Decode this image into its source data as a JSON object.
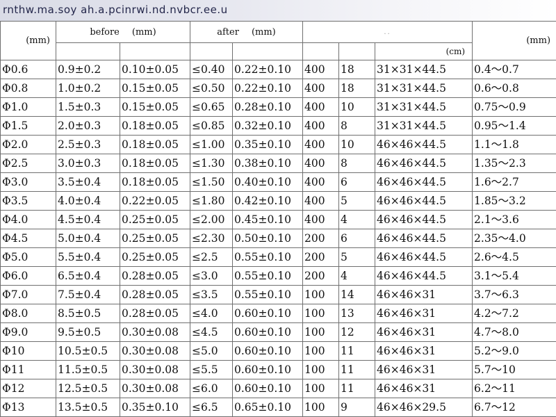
{
  "title": "rnthw.ma.soy ah.a.pcinrwi.nd.nvbcr.ee.u",
  "header": {
    "diameter_unit": "(mm)",
    "before_label": "before",
    "before_unit": "(mm)",
    "after_label": "after",
    "after_unit": "(mm)",
    "packing_mark": "..",
    "carton_unit": "(cm)",
    "range_unit": "(mm)"
  },
  "rows": [
    [
      "Φ0.6",
      "0.9±0.2",
      "0.10±0.05",
      "≤0.40",
      "0.22±0.10",
      "400",
      "18",
      "31×31×44.5",
      "0.4～0.7"
    ],
    [
      "Φ0.8",
      "1.0±0.2",
      "0.15±0.05",
      "≤0.50",
      "0.22±0.10",
      "400",
      "18",
      "31×31×44.5",
      "0.6～0.8"
    ],
    [
      "Φ1.0",
      "1.5±0.3",
      "0.15±0.05",
      "≤0.65",
      "0.28±0.10",
      "400",
      "10",
      "31×31×44.5",
      "0.75～0.9"
    ],
    [
      "Φ1.5",
      "2.0±0.3",
      "0.18±0.05",
      "≤0.85",
      "0.32±0.10",
      "400",
      "8",
      "31×31×44.5",
      "0.95～1.4"
    ],
    [
      "Φ2.0",
      "2.5±0.3",
      "0.18±0.05",
      "≤1.00",
      "0.35±0.10",
      "400",
      "10",
      "46×46×44.5",
      "1.1～1.8"
    ],
    [
      "Φ2.5",
      "3.0±0.3",
      "0.18±0.05",
      "≤1.30",
      "0.38±0.10",
      "400",
      "8",
      "46×46×44.5",
      "1.35～2.3"
    ],
    [
      "Φ3.0",
      "3.5±0.4",
      "0.18±0.05",
      "≤1.50",
      "0.40±0.10",
      "400",
      "6",
      "46×46×44.5",
      "1.6～2.7"
    ],
    [
      "Φ3.5",
      "4.0±0.4",
      "0.22±0.05",
      "≤1.80",
      "0.42±0.10",
      "400",
      "5",
      "46×46×44.5",
      "1.85～3.2"
    ],
    [
      "Φ4.0",
      "4.5±0.4",
      "0.25±0.05",
      "≤2.00",
      "0.45±0.10",
      "400",
      "4",
      "46×46×44.5",
      "2.1～3.6"
    ],
    [
      "Φ4.5",
      "5.0±0.4",
      "0.25±0.05",
      "≤2.30",
      "0.50±0.10",
      "200",
      "6",
      "46×46×44.5",
      "2.35～4.0"
    ],
    [
      "Φ5.0",
      "5.5±0.4",
      "0.25±0.05",
      "≤2.5",
      "0.55±0.10",
      "200",
      "5",
      "46×46×44.5",
      "2.6～4.5"
    ],
    [
      "Φ6.0",
      "6.5±0.4",
      "0.28±0.05",
      "≤3.0",
      "0.55±0.10",
      "200",
      "4",
      "46×46×44.5",
      "3.1～5.4"
    ],
    [
      "Φ7.0",
      "7.5±0.4",
      "0.28±0.05",
      "≤3.5",
      "0.55±0.10",
      "100",
      "14",
      "46×46×31",
      "3.7～6.3"
    ],
    [
      "Φ8.0",
      "8.5±0.5",
      "0.28±0.05",
      "≤4.0",
      "0.60±0.10",
      "100",
      "13",
      "46×46×31",
      "4.2～7.2"
    ],
    [
      "Φ9.0",
      "9.5±0.5",
      "0.30±0.08",
      "≤4.5",
      "0.60±0.10",
      "100",
      "12",
      "46×46×31",
      "4.7～8.0"
    ],
    [
      "Φ10",
      "10.5±0.5",
      "0.30±0.08",
      "≤5.0",
      "0.60±0.10",
      "100",
      "11",
      "46×46×31",
      "5.2～9.0"
    ],
    [
      "Φ11",
      "11.5±0.5",
      "0.30±0.08",
      "≤5.5",
      "0.60±0.10",
      "100",
      "11",
      "46×46×31",
      "5.7～10"
    ],
    [
      "Φ12",
      "12.5±0.5",
      "0.30±0.08",
      "≤6.0",
      "0.60±0.10",
      "100",
      "11",
      "46×46×31",
      "6.2～11"
    ],
    [
      "Φ13",
      "13.5±0.5",
      "0.35±0.10",
      "≤6.5",
      "0.65±0.10",
      "100",
      "9",
      "46×46×29.5",
      "6.7～12"
    ]
  ]
}
